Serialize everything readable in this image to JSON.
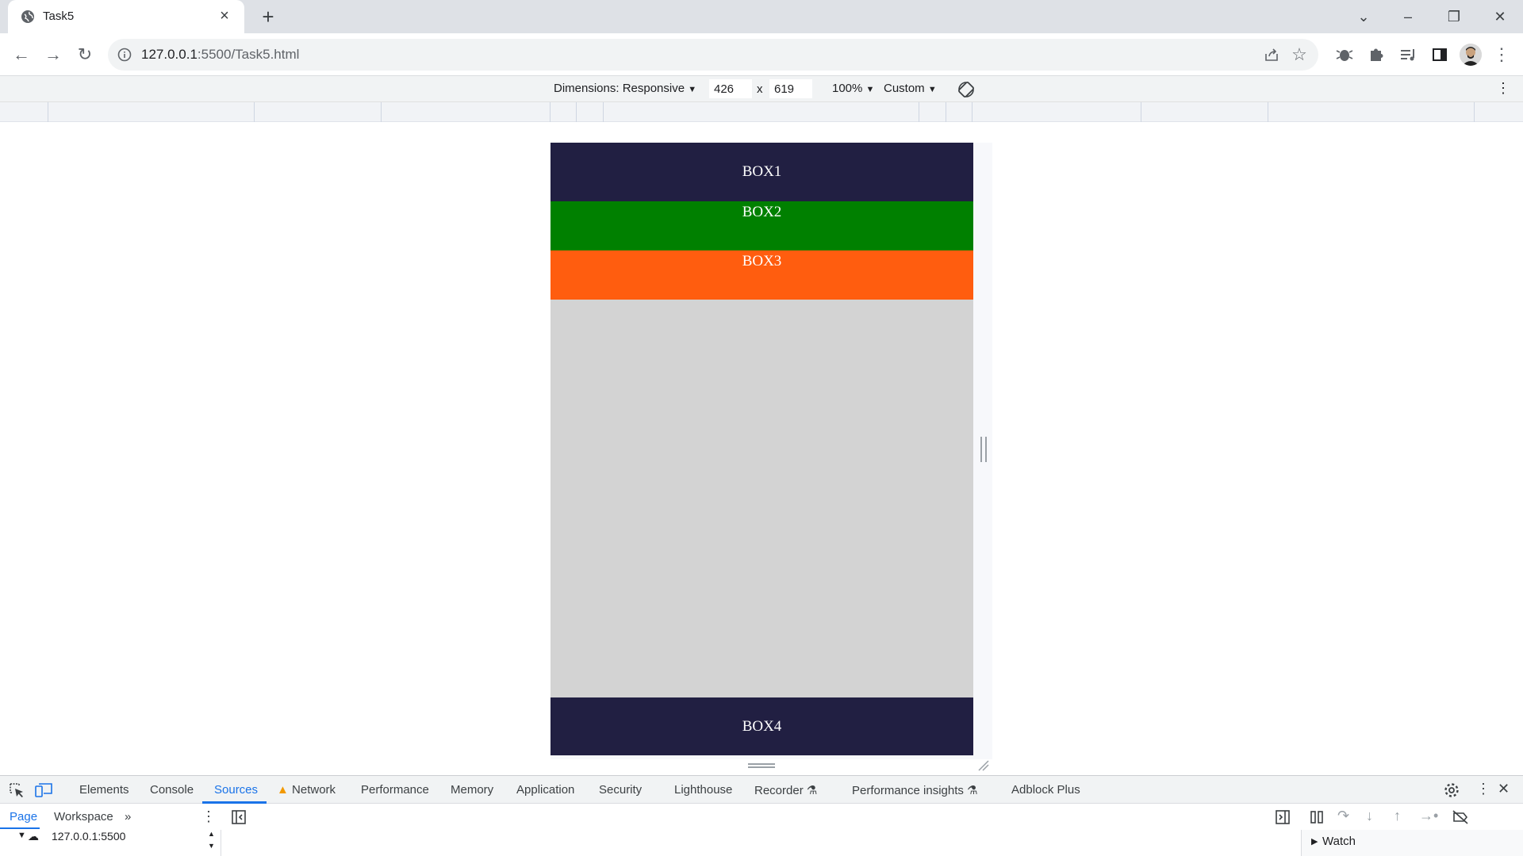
{
  "browser": {
    "tab_title": "Task5",
    "url_host": "127.0.0.1",
    "url_rest": ":5500/Task5.html"
  },
  "device_toolbar": {
    "dimensions_label": "Dimensions: Responsive",
    "width": "426",
    "times": "x",
    "height": "619",
    "zoom": "100%",
    "throttle": "Custom"
  },
  "page": {
    "boxes": [
      "BOX1",
      "BOX2",
      "BOX3",
      "BOX4"
    ],
    "colors": {
      "box1": "#211f42",
      "box2": "#008000",
      "box3": "#ff5d0f",
      "box4": "#211f42",
      "body": "#d3d3d3"
    }
  },
  "devtools": {
    "tabs": [
      "Elements",
      "Console",
      "Sources",
      "Network",
      "Performance",
      "Memory",
      "Application",
      "Security",
      "Lighthouse",
      "Recorder",
      "Performance insights",
      "Adblock Plus"
    ],
    "active_tab": "Sources",
    "sub_tabs": [
      "Page",
      "Workspace"
    ],
    "tree_root": "127.0.0.1:5500",
    "watch_label": "Watch"
  }
}
